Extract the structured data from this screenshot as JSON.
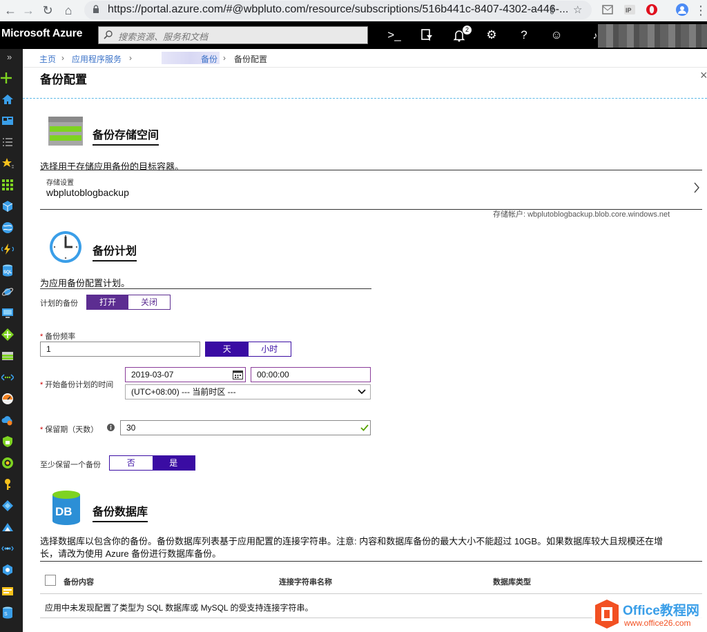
{
  "browser": {
    "url": "https://portal.azure.com/#@wbpluto.com/resource/subscriptions/516b441c-8407-4302-a446-..."
  },
  "header": {
    "brand": "Microsoft Azure",
    "search_placeholder": "搜索资源、服务和文档",
    "notification_count": "2"
  },
  "breadcrumb": {
    "home": "主页",
    "app_services": "应用程序服务",
    "backup": "备份",
    "current": "备份配置"
  },
  "blade": {
    "title": "备份配置"
  },
  "storage": {
    "title": "备份存储空间",
    "description": "选择用于存储应用备份的目标容器。",
    "setting_label": "存储设置",
    "setting_value": "wbplutoblogbackup",
    "account_note": "存储帐户: wbplutoblogbackup.blob.core.windows.net"
  },
  "schedule": {
    "title": "备份计划",
    "description": "为应用备份配置计划。",
    "scheduled_label": "计划的备份",
    "on_label": "打开",
    "off_label": "关闭",
    "frequency_label": "备份频率",
    "frequency_value": "1",
    "day_label": "天",
    "hour_label": "小时",
    "start_label": "开始备份计划的时间",
    "start_date": "2019-03-07",
    "start_time": "00:00:00",
    "timezone": "(UTC+08:00) --- 当前时区 ---",
    "retention_label": "保留期（天数）",
    "retention_value": "30",
    "keep_one_label": "至少保留一个备份",
    "no_label": "否",
    "yes_label": "是"
  },
  "database": {
    "title": "备份数据库",
    "description_line1": "选择数据库以包含你的备份。备份数据库列表基于应用配置的连接字符串。注意: 内容和数据库备份的最大大小不能超过 10GB。如果数据库较大且规模还在增",
    "description_line2": "长，请改为使用 Azure 备份进行数据库备份。",
    "columns": [
      "备份内容",
      "连接字符串名称",
      "数据库类型"
    ],
    "empty_message": "应用中未发现配置了类型为 SQL 数据库或 MySQL 的受支持连接字符串。",
    "icon_text": "DB"
  },
  "watermark": {
    "name": "Office教程网",
    "site": "www.office26.com"
  },
  "colors": {
    "purple": "#5c2d91",
    "link": "#3c73c8",
    "header_bg": "#000000"
  }
}
